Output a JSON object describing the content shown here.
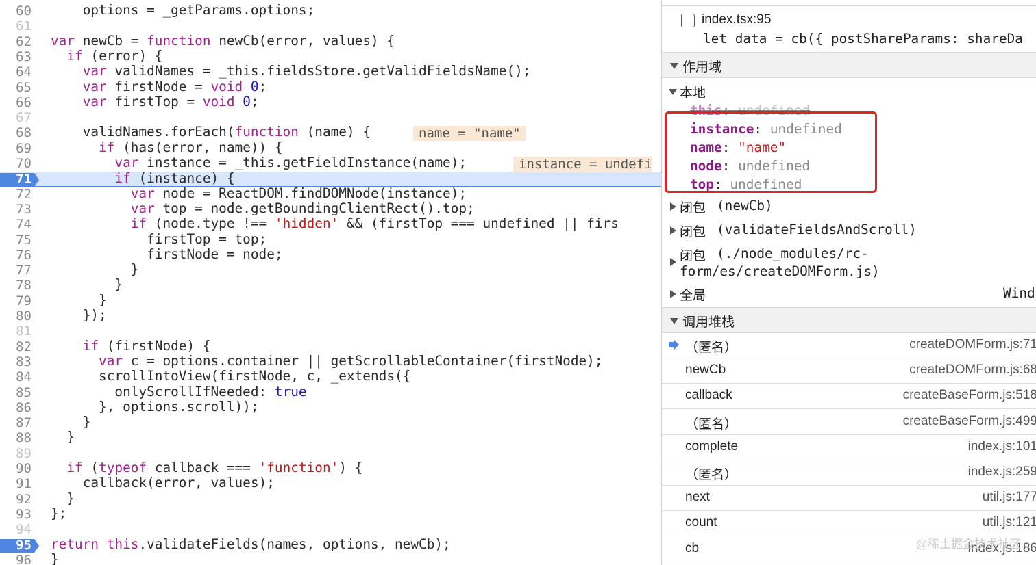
{
  "editor": {
    "lines": [
      {
        "n": "60",
        "segs": [
          [
            "t",
            "    options = _getParams.options;"
          ]
        ]
      },
      {
        "n": "61",
        "dim": true,
        "segs": []
      },
      {
        "n": "62",
        "segs": [
          [
            "k",
            "var"
          ],
          [
            "t",
            " newCb = "
          ],
          [
            "k",
            "function"
          ],
          [
            "t",
            " newCb(error, values) {"
          ]
        ]
      },
      {
        "n": "63",
        "segs": [
          [
            "t",
            "  "
          ],
          [
            "k",
            "if"
          ],
          [
            "t",
            " (error) {"
          ]
        ]
      },
      {
        "n": "64",
        "segs": [
          [
            "t",
            "    "
          ],
          [
            "k",
            "var"
          ],
          [
            "t",
            " validNames = _this.fieldsStore.getValidFieldsName();"
          ]
        ]
      },
      {
        "n": "65",
        "segs": [
          [
            "t",
            "    "
          ],
          [
            "k",
            "var"
          ],
          [
            "t",
            " firstNode = "
          ],
          [
            "k",
            "void"
          ],
          [
            "t",
            " "
          ],
          [
            "n",
            "0"
          ],
          [
            "t",
            ";"
          ]
        ]
      },
      {
        "n": "66",
        "segs": [
          [
            "t",
            "    "
          ],
          [
            "k",
            "var"
          ],
          [
            "t",
            " firstTop = "
          ],
          [
            "k",
            "void"
          ],
          [
            "t",
            " "
          ],
          [
            "n",
            "0"
          ],
          [
            "t",
            ";"
          ]
        ]
      },
      {
        "n": "67",
        "dim": true,
        "segs": []
      },
      {
        "n": "68",
        "segs": [
          [
            "t",
            "    validNames.forEach("
          ],
          [
            "k",
            "function"
          ],
          [
            "t",
            " (name) {"
          ]
        ]
      },
      {
        "n": "69",
        "segs": [
          [
            "t",
            "      "
          ],
          [
            "k",
            "if"
          ],
          [
            "t",
            " (has(error, name)) {"
          ]
        ]
      },
      {
        "n": "70",
        "segs": [
          [
            "t",
            "        "
          ],
          [
            "k",
            "var"
          ],
          [
            "t",
            " instance = _this.getFieldInstance(name);"
          ]
        ]
      },
      {
        "n": "71",
        "exec": true,
        "segs": [
          [
            "t",
            "        "
          ],
          [
            "k",
            "if"
          ],
          [
            "t",
            " (instance) {"
          ]
        ]
      },
      {
        "n": "72",
        "segs": [
          [
            "t",
            "          "
          ],
          [
            "k",
            "var"
          ],
          [
            "t",
            " node = ReactDOM.findDOMNode(instance);"
          ]
        ]
      },
      {
        "n": "73",
        "segs": [
          [
            "t",
            "          "
          ],
          [
            "k",
            "var"
          ],
          [
            "t",
            " top = node.getBoundingClientRect().top;"
          ]
        ]
      },
      {
        "n": "74",
        "segs": [
          [
            "t",
            "          "
          ],
          [
            "k",
            "if"
          ],
          [
            "t",
            " (node.type !== "
          ],
          [
            "s",
            "'hidden'"
          ],
          [
            "t",
            " && (firstTop === undefined || firs"
          ]
        ]
      },
      {
        "n": "75",
        "segs": [
          [
            "t",
            "            firstTop = top;"
          ]
        ]
      },
      {
        "n": "76",
        "segs": [
          [
            "t",
            "            firstNode = node;"
          ]
        ]
      },
      {
        "n": "77",
        "segs": [
          [
            "t",
            "          }"
          ]
        ]
      },
      {
        "n": "78",
        "segs": [
          [
            "t",
            "        }"
          ]
        ]
      },
      {
        "n": "79",
        "segs": [
          [
            "t",
            "      }"
          ]
        ]
      },
      {
        "n": "80",
        "segs": [
          [
            "t",
            "    });"
          ]
        ]
      },
      {
        "n": "81",
        "dim": true,
        "segs": []
      },
      {
        "n": "82",
        "segs": [
          [
            "t",
            "    "
          ],
          [
            "k",
            "if"
          ],
          [
            "t",
            " (firstNode) {"
          ]
        ]
      },
      {
        "n": "83",
        "segs": [
          [
            "t",
            "      "
          ],
          [
            "k",
            "var"
          ],
          [
            "t",
            " c = options.container || getScrollableContainer(firstNode);"
          ]
        ]
      },
      {
        "n": "84",
        "segs": [
          [
            "t",
            "      scrollIntoView(firstNode, c, _extends({"
          ]
        ]
      },
      {
        "n": "85",
        "segs": [
          [
            "t",
            "        onlyScrollIfNeeded: "
          ],
          [
            "n",
            "true"
          ]
        ]
      },
      {
        "n": "86",
        "segs": [
          [
            "t",
            "      }, options.scroll));"
          ]
        ]
      },
      {
        "n": "87",
        "segs": [
          [
            "t",
            "    }"
          ]
        ]
      },
      {
        "n": "88",
        "segs": [
          [
            "t",
            "  }"
          ]
        ]
      },
      {
        "n": "89",
        "dim": true,
        "segs": []
      },
      {
        "n": "90",
        "segs": [
          [
            "t",
            "  "
          ],
          [
            "k",
            "if"
          ],
          [
            "t",
            " ("
          ],
          [
            "k",
            "typeof"
          ],
          [
            "t",
            " callback === "
          ],
          [
            "s",
            "'function'"
          ],
          [
            "t",
            ") {"
          ]
        ]
      },
      {
        "n": "91",
        "segs": [
          [
            "t",
            "    callback(error, values);"
          ]
        ]
      },
      {
        "n": "92",
        "segs": [
          [
            "t",
            "  }"
          ]
        ]
      },
      {
        "n": "93",
        "segs": [
          [
            "t",
            "};"
          ]
        ]
      },
      {
        "n": "94",
        "dim": true,
        "segs": []
      },
      {
        "n": "95",
        "bp": true,
        "segs": [
          [
            "k",
            "return"
          ],
          [
            "t",
            " "
          ],
          [
            "k",
            "this"
          ],
          [
            "t",
            ".validateFields(names, options, newCb);"
          ]
        ]
      },
      {
        "n": "96",
        "segs": [
          [
            "t",
            "}"
          ]
        ]
      }
    ],
    "inline_values": [
      {
        "line": "68",
        "text": "name = \"name\""
      },
      {
        "line": "70",
        "text": "instance = undefi"
      }
    ],
    "colors": {
      "keyword": "#a3228f",
      "number": "#1c16c8",
      "string": "#c41a16",
      "exec_line": "#d8e6fb",
      "breakpoint": "#4f86df"
    }
  },
  "panel": {
    "breakpoint_file": "index.tsx:95",
    "breakpoint_code": "let data = cb({ postShareParams: shareDa",
    "scope_title": "作用域",
    "local_title": "本地",
    "local_vars": [
      {
        "name": "this",
        "value": "undefined",
        "struck": true
      },
      {
        "name": "instance",
        "value": "undefined"
      },
      {
        "name": "name",
        "value": "\"name\"",
        "is_string": true
      },
      {
        "name": "node",
        "value": "undefined"
      },
      {
        "name": "top",
        "value": "undefined"
      }
    ],
    "closures": [
      {
        "label": "闭包",
        "value": "(newCb)"
      },
      {
        "label": "闭包",
        "value": "(validateFieldsAndScroll)"
      },
      {
        "label": "闭包",
        "value": "(./node_modules/rc-",
        "value2": "form/es/createDOMForm.js)"
      }
    ],
    "global_label": "全局",
    "global_value": "Wind",
    "callstack_title": "调用堆栈",
    "callstack": [
      {
        "name": "（匿名）",
        "loc": "createDOMForm.js:71",
        "current": true
      },
      {
        "name": "newCb",
        "loc": "createDOMForm.js:68"
      },
      {
        "name": "callback",
        "loc": "createBaseForm.js:518"
      },
      {
        "name": "（匿名）",
        "loc": "createBaseForm.js:499"
      },
      {
        "name": "complete",
        "loc": "index.js:101"
      },
      {
        "name": "（匿名）",
        "loc": "index.js:259"
      },
      {
        "name": "next",
        "loc": "util.js:177"
      },
      {
        "name": "count",
        "loc": "util.js:121"
      },
      {
        "name": "cb",
        "loc": "index.js:186"
      }
    ],
    "watermark": "@稀土掘金技术社区"
  }
}
